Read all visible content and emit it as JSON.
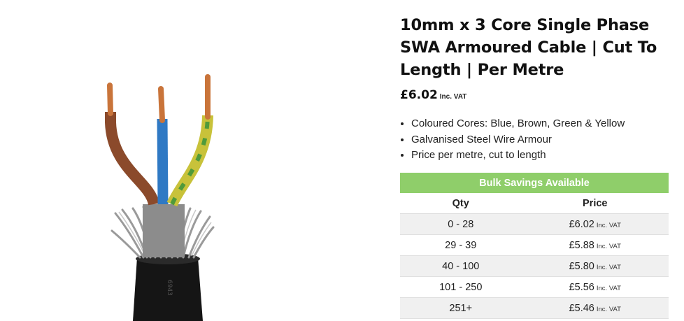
{
  "product": {
    "title": "10mm x 3 Core Single Phase SWA Armoured Cable | Cut To Length | Per Metre",
    "price": "£6.02",
    "vat_label": "Inc. VAT",
    "features": [
      "Coloured Cores: Blue, Brown, Green & Yellow",
      "Galvanised Steel Wire Armour",
      "Price per metre, cut to length"
    ]
  },
  "bulk": {
    "heading": "Bulk Savings Available",
    "headers": [
      "Qty",
      "Price"
    ],
    "rows": [
      {
        "qty": "0 - 28",
        "price": "£6.02",
        "vat": "Inc. VAT"
      },
      {
        "qty": "29 - 39",
        "price": "£5.88",
        "vat": "Inc. VAT"
      },
      {
        "qty": "40 - 100",
        "price": "£5.80",
        "vat": "Inc. VAT"
      },
      {
        "qty": "101 - 250",
        "price": "£5.56",
        "vat": "Inc. VAT"
      },
      {
        "qty": "251+",
        "price": "£5.46",
        "vat": "Inc. VAT"
      }
    ]
  },
  "colors": {
    "banner": "#8fce6a",
    "row_alt": "#f0f0f0",
    "core_brown": "#8b4a2b",
    "core_blue": "#2f79c4",
    "core_green_yellow": "#c8c23a",
    "sheath": "#1a1a1a",
    "copper": "#c9743a"
  }
}
